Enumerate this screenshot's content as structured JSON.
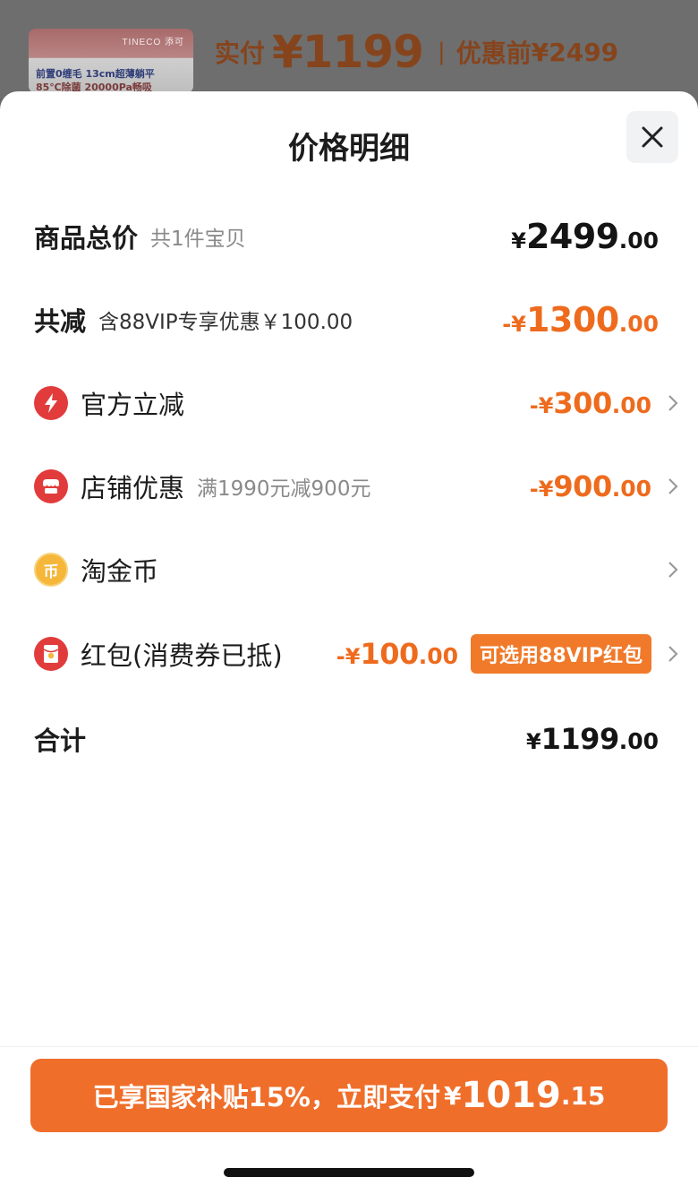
{
  "background": {
    "thumb_brand": "TINECO 添可",
    "thumb_line1": "前置0缠毛 13cm超薄躺平",
    "thumb_line2": "85℃除菌 20000Pa畅吸",
    "paid_label": "实付",
    "paid_amount": "¥1199",
    "separator": "|",
    "before_label": "优惠前",
    "before_amount": "¥2499"
  },
  "sheet": {
    "title": "价格明细",
    "close_icon": "close-icon"
  },
  "rows": {
    "total": {
      "label": "商品总价",
      "sub": "共1件宝贝",
      "yen": "¥",
      "int": "2499",
      "dec": ".00"
    },
    "reduce": {
      "label": "共减",
      "sub": "含88VIP专享优惠￥100.00",
      "yen": "-¥",
      "int": "1300",
      "dec": ".00"
    },
    "official": {
      "label": "官方立减",
      "icon": "lightning-icon",
      "yen": "-¥",
      "int": "300",
      "dec": ".00"
    },
    "store": {
      "label": "店铺优惠",
      "sub": "满1990元减900元",
      "icon": "store-icon",
      "yen": "-¥",
      "int": "900",
      "dec": ".00"
    },
    "coin": {
      "label": "淘金币",
      "icon": "coin-icon",
      "coin_char": "币"
    },
    "redpacket": {
      "label": "红包(消费券已抵)",
      "icon": "red-packet-icon",
      "yen": "-¥",
      "int": "100",
      "dec": ".00",
      "badge": "可选用88VIP红包"
    },
    "sum": {
      "label": "合计",
      "yen": "¥",
      "int": "1199",
      "dec": ".00"
    }
  },
  "pay_button": {
    "text": "已享国家补贴15%，立即支付",
    "yen": "¥",
    "int": "1019",
    "dec": ".15"
  },
  "colors": {
    "accent_orange": "#ef6e2a",
    "price_orange": "#ee6b1e",
    "icon_red": "#e23b3b",
    "coin_gold": "#f5b63a"
  }
}
